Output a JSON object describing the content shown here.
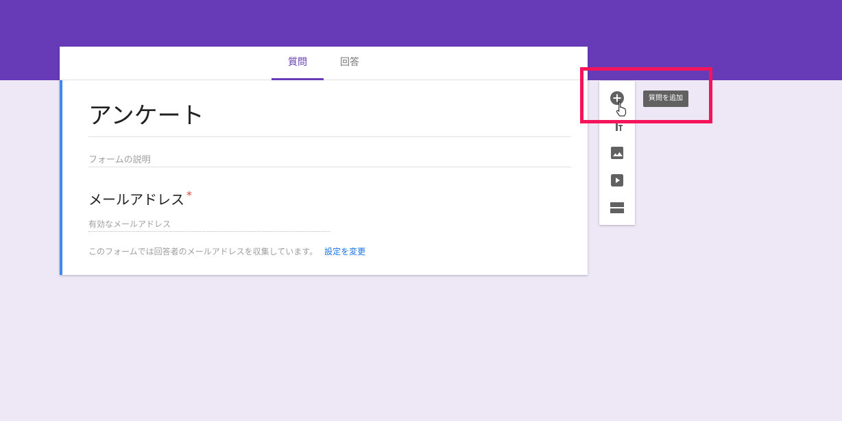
{
  "tabs": {
    "questions": "質問",
    "responses": "回答"
  },
  "form": {
    "title": "アンケート",
    "description_placeholder": "フォームの説明"
  },
  "question": {
    "title": "メールアドレス",
    "required_mark": "*",
    "input_placeholder": "有効なメールアドレス",
    "notice": "このフォームでは回答者のメールアドレスを収集しています。",
    "notice_link": "設定を変更"
  },
  "toolbar": {
    "tools": [
      "add-question-icon",
      "add-title-icon",
      "add-image-icon",
      "add-video-icon",
      "add-section-icon"
    ],
    "tooltip": "質問を追加"
  },
  "colors": {
    "header": "#673ab7",
    "background": "#ede7f6",
    "accent": "#4285f4",
    "highlight": "#f5145a",
    "icon": "#616161"
  }
}
